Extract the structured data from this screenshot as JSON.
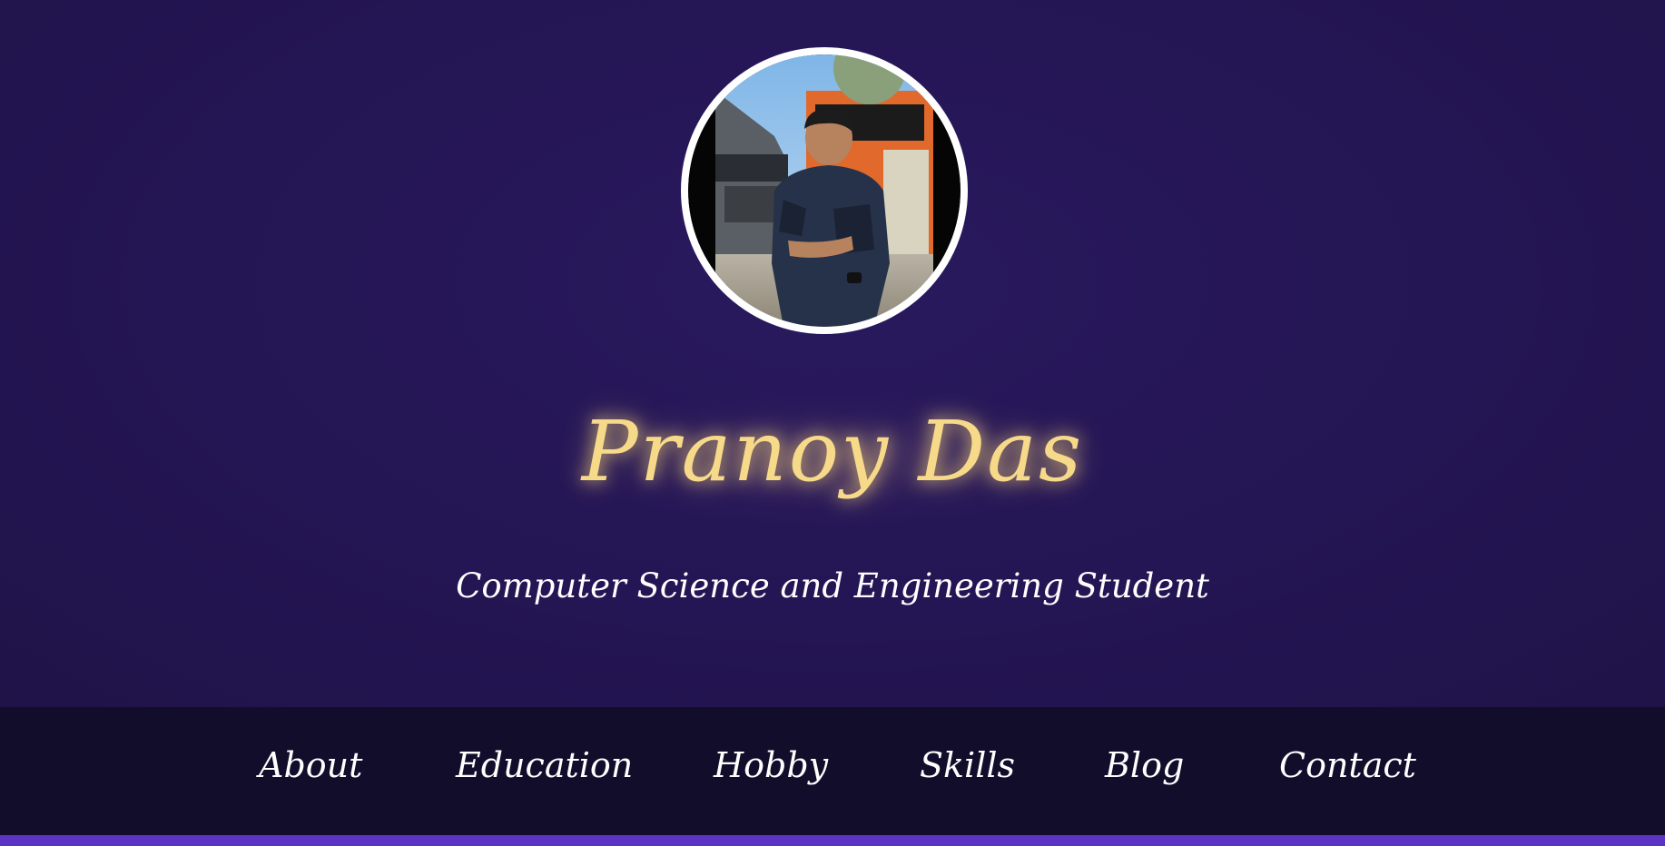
{
  "profile": {
    "photo_alt": "profile-photo",
    "name": "Pranoy Das",
    "subtitle": "Computer Science and Engineering Student"
  },
  "nav": {
    "items": [
      {
        "label": "About"
      },
      {
        "label": "Education"
      },
      {
        "label": "Hobby"
      },
      {
        "label": "Skills"
      },
      {
        "label": "Blog"
      },
      {
        "label": "Contact"
      }
    ]
  },
  "colors": {
    "background": "#251656",
    "name_accent": "#f7d98a",
    "navbar": "#130d2c",
    "bottom_bar": "#5b34c4",
    "text": "#ffffff"
  }
}
